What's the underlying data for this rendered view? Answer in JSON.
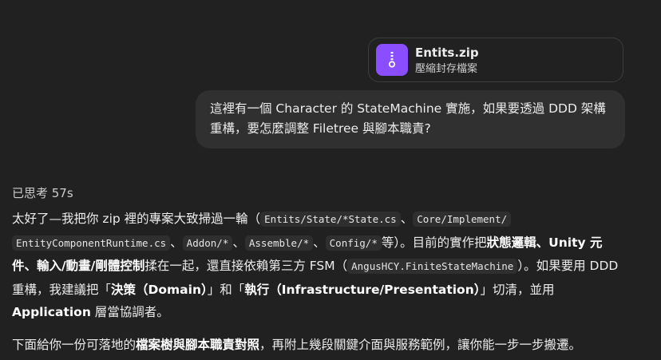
{
  "attachment": {
    "file_name": "Entits.zip",
    "file_type": "壓縮封存檔案",
    "icon": "zip-file-icon",
    "icon_color": "#8a4dff"
  },
  "user_message": {
    "text": "這裡有一個 Character 的 StateMachine 實施，如果要透過 DDD 架構重構，要怎麼調整 Filetree 與腳本職責?"
  },
  "assistant": {
    "thought_label": "已思考 57s",
    "p1": {
      "t1": "太好了—我把你 zip 裡的專案大致掃過一輪（",
      "c1": "Entits/State/*State.cs",
      "t2": "、",
      "c2": "Core/Implement/",
      "c3": "EntityComponentRuntime.cs",
      "t3": "、",
      "c4": "Addon/*",
      "t4": "、",
      "c5": "Assemble/*",
      "t5": "、",
      "c6": "Config/*",
      "t6": "等）。目前的實作把",
      "b1": "狀態邏輯、Unity 元件、輸入/動畫/剛體控制",
      "t7": "揉在一起，還直接依賴第三方 FSM（",
      "c7": "AngusHCY.FiniteStateMachine",
      "t8": "）。如果要用 DDD 重構，我建議把「",
      "b2": "決策（Domain）",
      "t9": "」和「",
      "b3": "執行（Infrastructure/Presentation）",
      "t10": "」切清，並用 ",
      "b4": "Application",
      "t11": " 層當協調者。"
    },
    "p2": {
      "t1": "下面給你一份可落地的",
      "b1": "檔案樹與腳本職責對照",
      "t2": "，再附上幾段關鍵介面與服務範例，讓你能一步一步搬遷。"
    }
  }
}
